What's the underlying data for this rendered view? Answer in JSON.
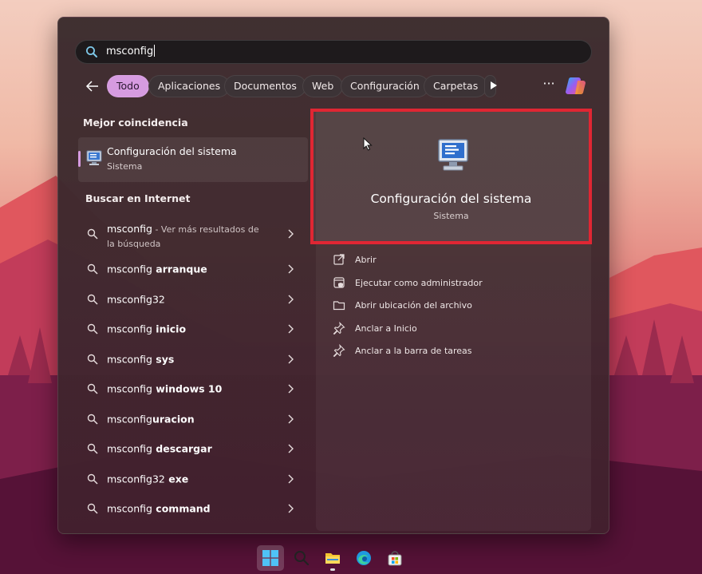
{
  "search": {
    "query": "msconfig"
  },
  "filters": {
    "chips": [
      "Todo",
      "Aplicaciones",
      "Documentos",
      "Web",
      "Configuración",
      "Carpetas"
    ],
    "active": "Todo"
  },
  "best_match": {
    "section_title": "Mejor coincidencia",
    "app_name": "Configuración del sistema",
    "app_type": "Sistema"
  },
  "web_search": {
    "section_title": "Buscar en Internet",
    "items": [
      {
        "prefix": "msconfig",
        "suffix": " - Ver más resultados de la búsqueda"
      },
      {
        "prefix": "msconfig",
        "suffix": " arranque"
      },
      {
        "prefix": "msconfig32",
        "suffix": ""
      },
      {
        "prefix": "msconfig",
        "suffix": " inicio"
      },
      {
        "prefix": "msconfig",
        "suffix": " sys"
      },
      {
        "prefix": "msconfig",
        "suffix": " windows 10"
      },
      {
        "prefix": "msconfig",
        "suffix": "uracion"
      },
      {
        "prefix": "msconfig",
        "suffix": " descargar"
      },
      {
        "prefix": "msconfig32",
        "suffix": " exe"
      },
      {
        "prefix": "msconfig",
        "suffix": " command"
      }
    ]
  },
  "preview": {
    "title": "Configuración del sistema",
    "subtitle": "Sistema",
    "highlight_color": "#e02633"
  },
  "actions": [
    {
      "label": "Abrir",
      "icon": "open-external-icon"
    },
    {
      "label": "Ejecutar como administrador",
      "icon": "shield-admin-icon"
    },
    {
      "label": "Abrir ubicación del archivo",
      "icon": "folder-icon"
    },
    {
      "label": "Anclar a Inicio",
      "icon": "pin-icon"
    },
    {
      "label": "Anclar a la barra de tareas",
      "icon": "pin-icon"
    }
  ],
  "taskbar": {
    "items": [
      "windows-start-icon",
      "search-icon",
      "file-explorer-icon",
      "edge-icon",
      "store-icon"
    ]
  },
  "colors": {
    "accent": "#d69be0"
  }
}
